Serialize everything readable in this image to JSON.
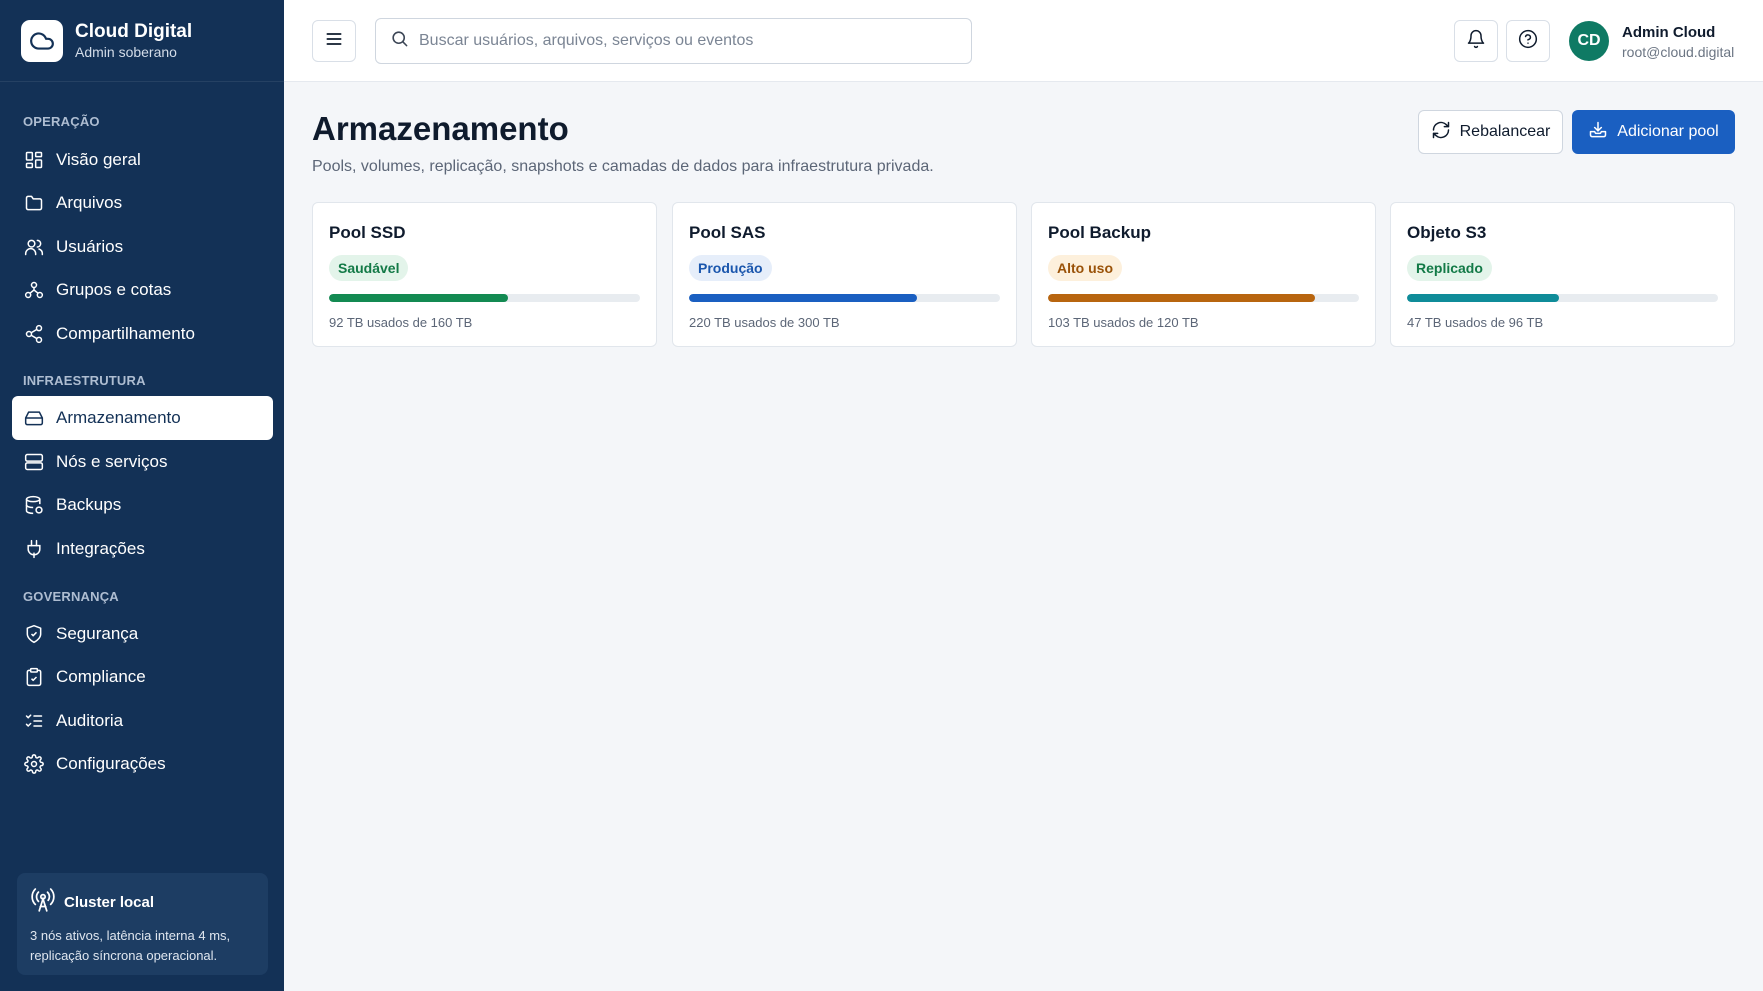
{
  "brand": {
    "title": "Cloud Digital",
    "subtitle": "Admin soberano"
  },
  "sidebar": {
    "sections": [
      {
        "label": "OPERAÇÃO"
      },
      {
        "label": "INFRAESTRUTURA"
      },
      {
        "label": "GOVERNANÇA"
      }
    ],
    "items": [
      {
        "label": "Visão geral",
        "icon": "grid-icon"
      },
      {
        "label": "Arquivos",
        "icon": "folder-icon"
      },
      {
        "label": "Usuários",
        "icon": "users-icon"
      },
      {
        "label": "Grupos e cotas",
        "icon": "groups-icon"
      },
      {
        "label": "Compartilhamento",
        "icon": "share-icon"
      },
      {
        "label": "Armazenamento",
        "icon": "drive-icon",
        "active": true
      },
      {
        "label": "Nós e serviços",
        "icon": "server-icon"
      },
      {
        "label": "Backups",
        "icon": "database-backup-icon"
      },
      {
        "label": "Integrações",
        "icon": "plug-icon"
      },
      {
        "label": "Segurança",
        "icon": "shield-icon"
      },
      {
        "label": "Compliance",
        "icon": "clipboard-check-icon"
      },
      {
        "label": "Auditoria",
        "icon": "list-checks-icon"
      },
      {
        "label": "Configurações",
        "icon": "gear-icon"
      }
    ],
    "cluster": {
      "title": "Cluster local",
      "text": "3 nós ativos, latência interna 4 ms, replicação síncrona operacional."
    }
  },
  "topbar": {
    "search_placeholder": "Buscar usuários, arquivos, serviços ou eventos",
    "user": {
      "initials": "CD",
      "name": "Admin Cloud",
      "email": "root@cloud.digital"
    }
  },
  "main": {
    "title": "Armazenamento",
    "subtitle": "Pools, volumes, replicação, snapshots e camadas de dados para infraestrutura privada.",
    "rebalance_label": "Rebalancear",
    "add_pool_label": "Adicionar pool",
    "pools": [
      {
        "name": "Pool SSD",
        "status": "Saudável",
        "usage": "92 TB usados de 160 TB",
        "used": 92,
        "total": 160,
        "color": "#138a52",
        "badge_bg": "#e3f4ea",
        "badge_fg": "#137a47"
      },
      {
        "name": "Pool SAS",
        "status": "Produção",
        "usage": "220 TB usados de 300 TB",
        "used": 220,
        "total": 300,
        "color": "#1a5fc1",
        "badge_bg": "#e6eefa",
        "badge_fg": "#1a56ad"
      },
      {
        "name": "Pool Backup",
        "status": "Alto uso",
        "usage": "103 TB usados de 120 TB",
        "used": 103,
        "total": 120,
        "color": "#b8650f",
        "badge_bg": "#fdf0dc",
        "badge_fg": "#9a5208"
      },
      {
        "name": "Objeto S3",
        "status": "Replicado",
        "usage": "47 TB usados de 96 TB",
        "used": 47,
        "total": 96,
        "color": "#0f8c99",
        "badge_bg": "#e3f4ea",
        "badge_fg": "#137a47"
      }
    ]
  }
}
